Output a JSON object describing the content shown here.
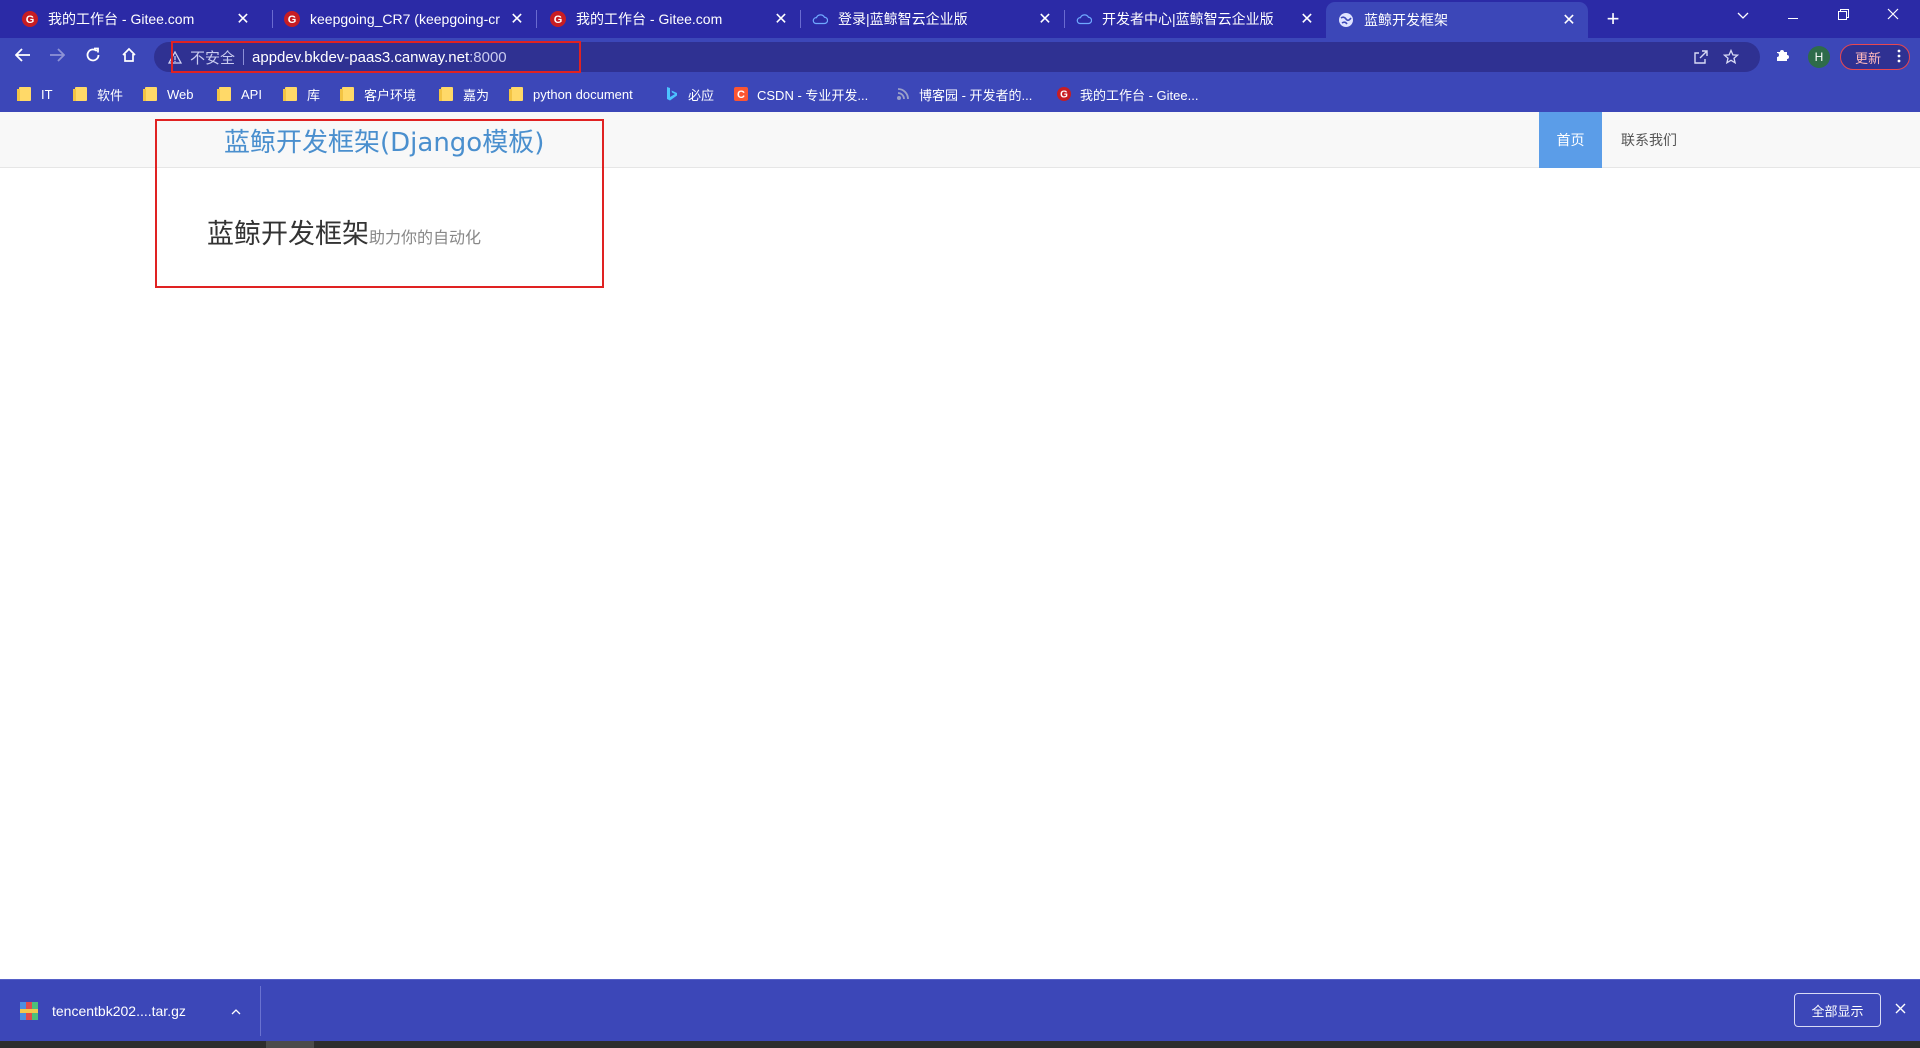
{
  "tabs": [
    {
      "title": "我的工作台 - Gitee.com",
      "icon": "gitee-icon",
      "active": false
    },
    {
      "title": "keepgoing_CR7 (keepgoing-cr",
      "icon": "gitee-icon",
      "active": false
    },
    {
      "title": "我的工作台 - Gitee.com",
      "icon": "gitee-icon",
      "active": false
    },
    {
      "title": "登录|蓝鲸智云企业版",
      "icon": "cloud-icon",
      "active": false
    },
    {
      "title": "开发者中心|蓝鲸智云企业版",
      "icon": "cloud-icon",
      "active": false
    },
    {
      "title": "蓝鲸开发框架",
      "icon": "globe-icon",
      "active": true
    }
  ],
  "address_bar": {
    "security_label": "不安全",
    "host": "appdev.bkdev-paas3.canway.net",
    "port": ":8000"
  },
  "toolbar": {
    "profile_initial": "H",
    "update_label": "更新"
  },
  "bookmarks": [
    {
      "label": "IT",
      "icon": "folder-icon"
    },
    {
      "label": "软件",
      "icon": "folder-icon"
    },
    {
      "label": "Web",
      "icon": "folder-icon"
    },
    {
      "label": "API",
      "icon": "folder-icon"
    },
    {
      "label": "库",
      "icon": "folder-icon"
    },
    {
      "label": "客户环境",
      "icon": "folder-icon"
    },
    {
      "label": "嘉为",
      "icon": "folder-icon"
    },
    {
      "label": "python document",
      "icon": "folder-icon"
    },
    {
      "label": "必应",
      "icon": "bing-icon"
    },
    {
      "label": "CSDN - 专业开发...",
      "icon": "csdn-icon"
    },
    {
      "label": "博客园 - 开发者的...",
      "icon": "cnblogs-icon"
    },
    {
      "label": "我的工作台 - Gitee...",
      "icon": "gitee-icon"
    }
  ],
  "page": {
    "brand": "蓝鲸开发框架(Django模板)",
    "nav": {
      "home": "首页",
      "contact": "联系我们"
    },
    "hero_title": "蓝鲸开发框架",
    "hero_subtitle": "助力你的自动化"
  },
  "downloads": {
    "file_name": "tencentbk202....tar.gz",
    "show_all": "全部显示"
  },
  "colors": {
    "tabstrip": "#2b2aa6",
    "toolbar": "#3c47b8",
    "brand": "#4a8fce",
    "nav_active": "#5b9de8",
    "annotation": "#e02222"
  }
}
